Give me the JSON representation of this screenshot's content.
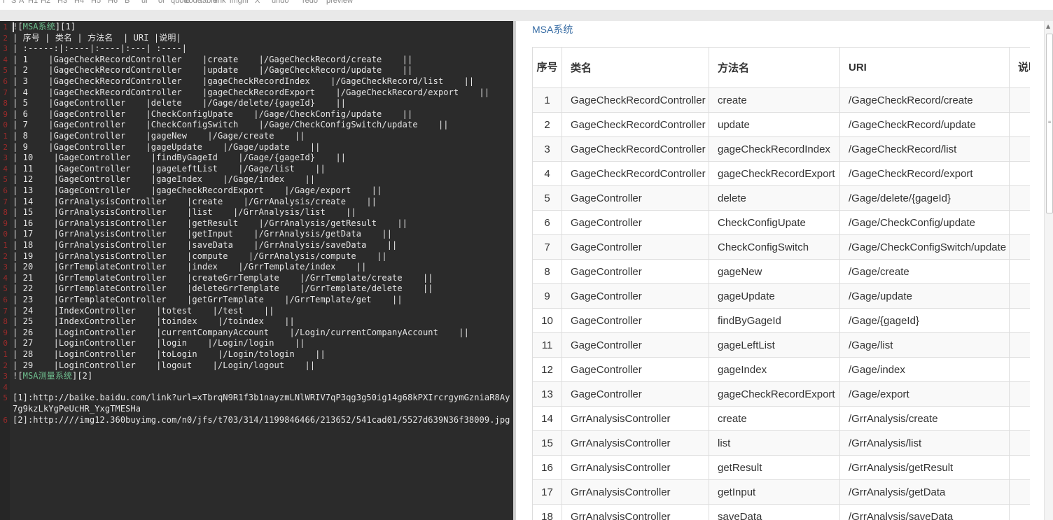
{
  "toolbar": {
    "buttons": [
      "I",
      "S",
      "A",
      "H1",
      "H2",
      "H3",
      "H4",
      "H5",
      "H6",
      "B",
      "ul",
      "ol",
      "quote",
      "code",
      "table",
      "link",
      "img",
      "hr",
      "X",
      "undo",
      "redo",
      "preview"
    ]
  },
  "editor": {
    "lines": [
      "![MSA系统][1]",
      "| 序号 | 类名 | 方法名  | URI |说明|",
      "| :-----:|:----|:----|:---| :----|",
      "| 1    |GageCheckRecordController    |create    |/GageCheckRecord/create    ||",
      "| 2    |GageCheckRecordController    |update    |/GageCheckRecord/update    ||",
      "| 3    |GageCheckRecordController    |gageCheckRecordIndex    |/GageCheckRecord/list    ||",
      "| 4    |GageCheckRecordController    |gageCheckRecordExport    |/GageCheckRecord/export    ||",
      "| 5    |GageController    |delete    |/Gage/delete/{gageId}    ||",
      "| 6    |GageController    |CheckConfigUpate    |/Gage/CheckConfig/update    ||",
      "| 7    |GageController    |CheckConfigSwitch    |/Gage/CheckConfigSwitch/update    ||",
      "| 8    |GageController    |gageNew    |/Gage/create    ||",
      "| 9    |GageController    |gageUpdate    |/Gage/update    ||",
      "| 10    |GageController    |findByGageId    |/Gage/{gageId}    ||",
      "| 11    |GageController    |gageLeftList    |/Gage/list    ||",
      "| 12    |GageController    |gageIndex    |/Gage/index    ||",
      "| 13    |GageController    |gageCheckRecordExport    |/Gage/export    ||",
      "| 14    |GrrAnalysisController    |create    |/GrrAnalysis/create    ||",
      "| 15    |GrrAnalysisController    |list    |/GrrAnalysis/list    ||",
      "| 16    |GrrAnalysisController    |getResult    |/GrrAnalysis/getResult    ||",
      "| 17    |GrrAnalysisController    |getInput    |/GrrAnalysis/getData    ||",
      "| 18    |GrrAnalysisController    |saveData    |/GrrAnalysis/saveData    ||",
      "| 19    |GrrAnalysisController    |compute    |/GrrAnalysis/compute    ||",
      "| 20    |GrrTemplateController    |index    |/GrrTemplate/index    ||",
      "| 21    |GrrTemplateController    |createGrrTemplate    |/GrrTemplate/create    ||",
      "| 22    |GrrTemplateController    |deleteGrrTemplate    |/GrrTemplate/delete    ||",
      "| 23    |GrrTemplateController    |getGrrTemplate    |/GrrTemplate/get    ||",
      "| 24    |IndexController    |totest    |/test    ||",
      "| 25    |IndexController    |toindex    |/toindex    ||",
      "| 26    |LoginController    |currentCompanyAccount    |/Login/currentCompanyAccount    ||",
      "| 27    |LoginController    |login    |/Login/login    ||",
      "| 28    |LoginController    |toLogin    |/Login/tologin    ||",
      "| 29    |LoginController    |logout    |/Login/logout    ||",
      "![MSA测量系统][2]",
      "",
      "[1]:http://baike.baidu.com/link?url=xTbrqN9R1f3b1nayzmLNlWRIV7qP3qg3g50ig14g68kPXIrcrgymGzniaR8Ay",
      "7g9kzLkYgPeUcHR_YxgTMESHa",
      "[2]:http:////img12.360buyimg.com/n0/jfs/t703/314/1199846466/213652/541cad01/5527d639N36f38009.jpg"
    ],
    "gutter_numbers": [
      "1",
      "2",
      "3",
      "4",
      "5",
      "6",
      "7",
      "8",
      "9",
      "0",
      "1",
      "2",
      "3",
      "4",
      "5",
      "6",
      "7",
      "8",
      "9",
      "0",
      "1",
      "2",
      "3",
      "4",
      "5",
      "6",
      "7",
      "8",
      "9",
      "0",
      "1",
      "2",
      "3",
      "4",
      "5",
      "",
      "6"
    ]
  },
  "preview": {
    "title": "MSA系统",
    "headers": [
      "序号",
      "类名",
      "方法名",
      "URI",
      "说明"
    ],
    "rows": [
      [
        "1",
        "GageCheckRecordController",
        "create",
        "/GageCheckRecord/create",
        ""
      ],
      [
        "2",
        "GageCheckRecordController",
        "update",
        "/GageCheckRecord/update",
        ""
      ],
      [
        "3",
        "GageCheckRecordController",
        "gageCheckRecordIndex",
        "/GageCheckRecord/list",
        ""
      ],
      [
        "4",
        "GageCheckRecordController",
        "gageCheckRecordExport",
        "/GageCheckRecord/export",
        ""
      ],
      [
        "5",
        "GageController",
        "delete",
        "/Gage/delete/{gageId}",
        ""
      ],
      [
        "6",
        "GageController",
        "CheckConfigUpate",
        "/Gage/CheckConfig/update",
        ""
      ],
      [
        "7",
        "GageController",
        "CheckConfigSwitch",
        "/Gage/CheckConfigSwitch/update",
        ""
      ],
      [
        "8",
        "GageController",
        "gageNew",
        "/Gage/create",
        ""
      ],
      [
        "9",
        "GageController",
        "gageUpdate",
        "/Gage/update",
        ""
      ],
      [
        "10",
        "GageController",
        "findByGageId",
        "/Gage/{gageId}",
        ""
      ],
      [
        "11",
        "GageController",
        "gageLeftList",
        "/Gage/list",
        ""
      ],
      [
        "12",
        "GageController",
        "gageIndex",
        "/Gage/index",
        ""
      ],
      [
        "13",
        "GageController",
        "gageCheckRecordExport",
        "/Gage/export",
        ""
      ],
      [
        "14",
        "GrrAnalysisController",
        "create",
        "/GrrAnalysis/create",
        ""
      ],
      [
        "15",
        "GrrAnalysisController",
        "list",
        "/GrrAnalysis/list",
        ""
      ],
      [
        "16",
        "GrrAnalysisController",
        "getResult",
        "/GrrAnalysis/getResult",
        ""
      ],
      [
        "17",
        "GrrAnalysisController",
        "getInput",
        "/GrrAnalysis/getData",
        ""
      ],
      [
        "18",
        "GrrAnalysisController",
        "saveData",
        "/GrrAnalysis/saveData",
        ""
      ]
    ]
  },
  "colors": {
    "editor_bg": "#2b2b2b",
    "editor_text": "#e6e6e6",
    "link_text": "#6fbf8f",
    "gutter_text": "#9a2a2a",
    "title_link": "#3a6ea5"
  }
}
